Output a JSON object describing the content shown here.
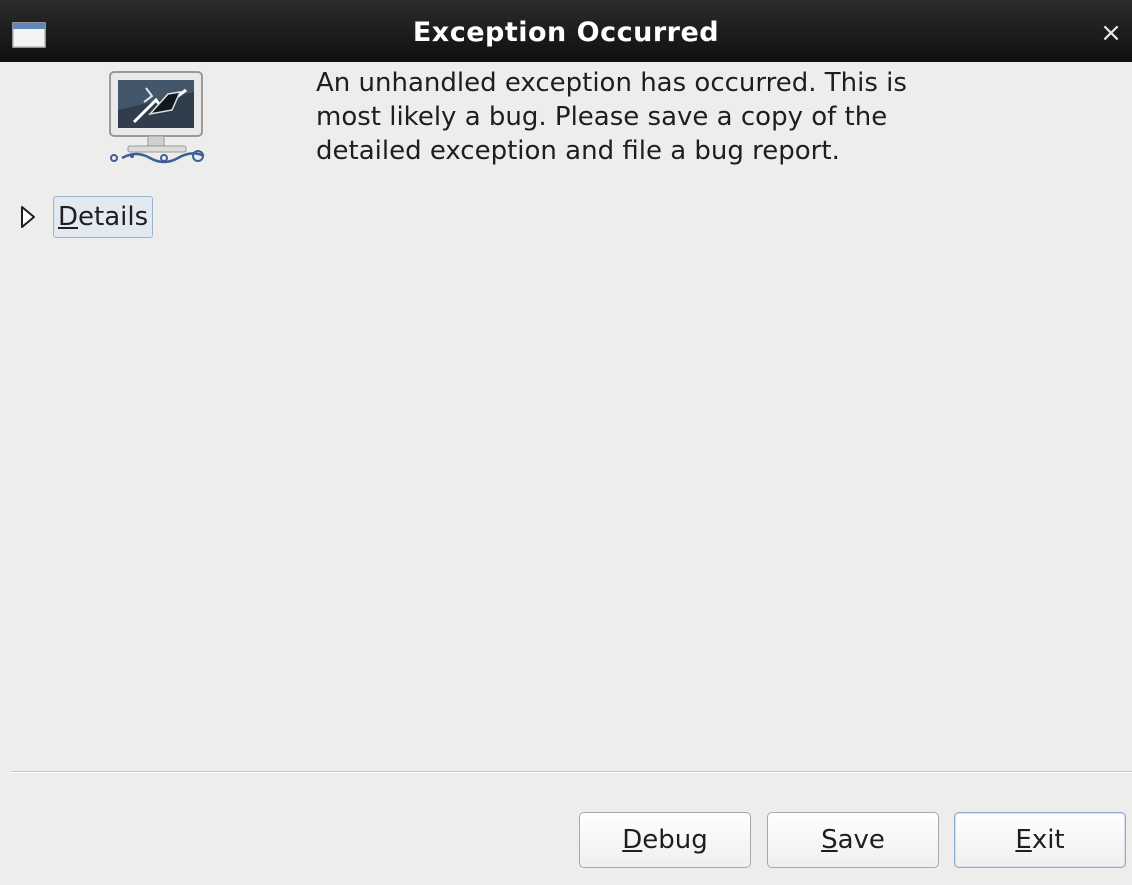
{
  "window": {
    "title": "Exception Occurred",
    "close_symbol": "×"
  },
  "message": {
    "lines": [
      "An unhandled exception has occurred.  This is",
      "most likely a bug.  Please save a copy of the",
      "detailed exception and file a bug report."
    ]
  },
  "details": {
    "mnemonic": "D",
    "rest": "etails",
    "expanded": false
  },
  "buttons": {
    "debug": {
      "mnemonic": "D",
      "rest": "ebug"
    },
    "save": {
      "mnemonic": "S",
      "rest": "ave"
    },
    "exit": {
      "mnemonic": "E",
      "rest": "xit"
    }
  },
  "colors": {
    "titlebar": "#1a1a1a",
    "background": "#ededec",
    "focus_border": "#8eabd0"
  }
}
